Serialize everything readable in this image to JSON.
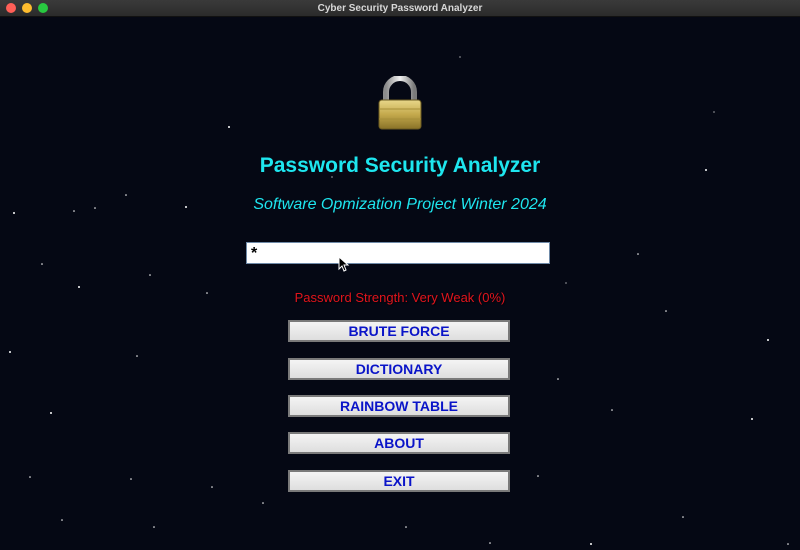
{
  "window": {
    "title": "Cyber Security Password Analyzer"
  },
  "header": {
    "icon": "padlock-icon",
    "title": "Password Security Analyzer",
    "subtitle": "Software Opmization Project Winter 2024"
  },
  "password_field": {
    "value": "*"
  },
  "strength": {
    "text": "Password Strength: Very Weak (0%)",
    "color": "#e0141c"
  },
  "buttons": [
    {
      "label": "BRUTE FORCE"
    },
    {
      "label": "DICTIONARY"
    },
    {
      "label": "RAINBOW TABLE"
    },
    {
      "label": "ABOUT"
    },
    {
      "label": "EXIT"
    }
  ],
  "colors": {
    "background": "#050814",
    "accent": "#1ee6ef",
    "button_text": "#0a14c8"
  }
}
